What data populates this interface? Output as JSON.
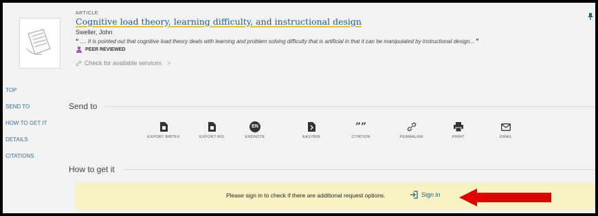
{
  "record": {
    "type": "ARTICLE",
    "title": "Cognitive load theory, learning difficulty, and instructional design",
    "author": "Sweller, John",
    "snippet_open": "“",
    "snippet": ".... It is pointed out that cognitive load theory deals with learning and problem solving difficulty that is artificial in that it can be manipulated by instructional design...",
    "snippet_close": "”",
    "peer_reviewed": "PEER REVIEWED",
    "services": "Check for available services",
    "services_chevron": ">"
  },
  "sidenav": [
    "TOP",
    "SEND TO",
    "HOW TO GET IT",
    "DETAILS",
    "CITATIONS"
  ],
  "send_to": {
    "heading": "Send to",
    "actions": [
      {
        "label": "EXPORT BIBTEX",
        "icon": "file-icon"
      },
      {
        "label": "EXPORT RIS",
        "icon": "file-icon"
      },
      {
        "label": "ENDNOTE",
        "icon": "endnote-icon",
        "badge": "EN"
      },
      {
        "label": "EASYBIB",
        "icon": "easybib-icon"
      },
      {
        "label": "CITATION",
        "icon": "quote-icon",
        "glyph": "””"
      },
      {
        "label": "PERMALINK",
        "icon": "link-icon"
      },
      {
        "label": "PRINT",
        "icon": "printer-icon"
      },
      {
        "label": "EMAIL",
        "icon": "mail-icon"
      }
    ]
  },
  "how_to": {
    "heading": "How to get it",
    "message": "Please sign in to check if there are additional request options.",
    "signin": "Sign in"
  },
  "colors": {
    "link": "#1a5e86",
    "highlight_underline": "#e8c42c",
    "bar_bg": "#f8f1c4",
    "arrow": "#e00000"
  }
}
